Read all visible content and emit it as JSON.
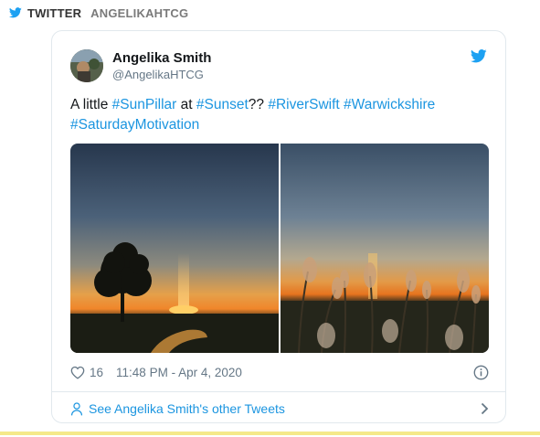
{
  "header": {
    "source_label": "TWITTER",
    "source_handle": "ANGELIKAHTCG"
  },
  "tweet": {
    "author_name": "Angelika Smith",
    "author_handle": "@AngelikaHTCG",
    "text_parts": {
      "p1": "A little ",
      "h1": "#SunPillar",
      "p2": " at ",
      "h2": "#Sunset",
      "p3": "?? ",
      "h3": "#RiverSwift",
      "p4": " ",
      "h4": "#Warwickshire",
      "p5": " ",
      "h5": "#SaturdayMotivation"
    },
    "like_count": "16",
    "timestamp": "11:48 PM - Apr 4, 2020",
    "more_tweets_label": "See Angelika Smith's other Tweets"
  },
  "icons": {
    "header": "twitter-bird-icon",
    "card": "twitter-bird-icon",
    "likes": "heart-icon",
    "info": "info-icon",
    "profile": "person-icon",
    "navigate": "chevron-right-icon"
  },
  "colors": {
    "twitter_blue": "#1da1f2",
    "link_blue": "#1b95e0",
    "text_primary": "#14171a",
    "text_secondary": "#657786",
    "border": "#e1e8ed",
    "accent_line": "#f5e98a"
  }
}
